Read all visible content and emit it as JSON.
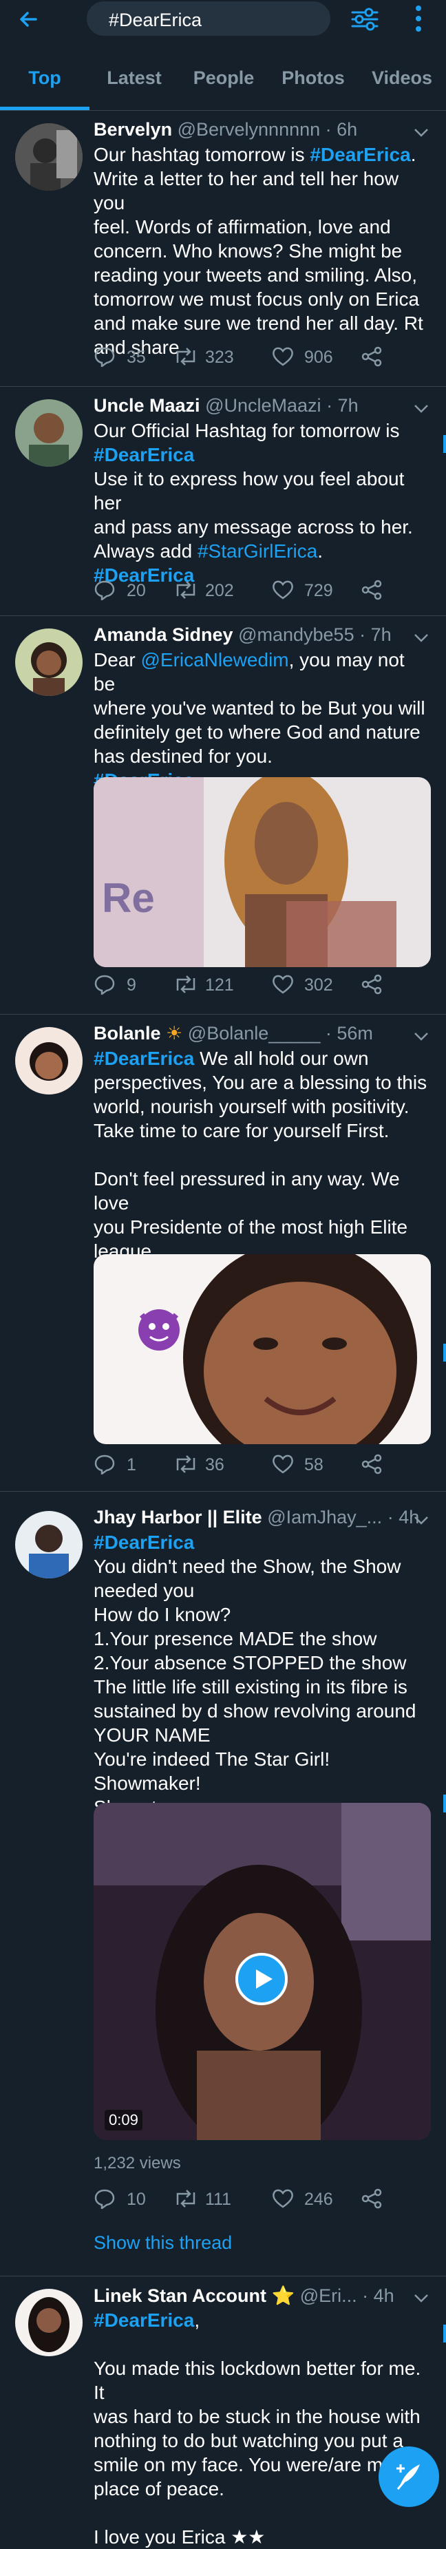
{
  "search": {
    "query": "#DearErica"
  },
  "tabs": [
    "Top",
    "Latest",
    "People",
    "Photos",
    "Videos"
  ],
  "tweets": [
    {
      "name": "Bervelyn",
      "handle": "@Bervelynnnnnn",
      "time": "· 6h",
      "lines": [
        [
          {
            "t": "Our hashtag tomorrow is "
          },
          {
            "t": "#DearErica",
            "c": "hash"
          },
          {
            "t": "."
          }
        ],
        [
          {
            "t": "Write a letter to her and tell her how you"
          }
        ],
        [
          {
            "t": "feel. Words of affirmation, love and"
          }
        ],
        [
          {
            "t": "concern. Who knows? She might be"
          }
        ],
        [
          {
            "t": "reading your tweets and smiling. Also,"
          }
        ],
        [
          {
            "t": "tomorrow we must focus only on Erica"
          }
        ],
        [
          {
            "t": "and make sure we trend her all day. Rt"
          }
        ],
        [
          {
            "t": "and share"
          }
        ]
      ],
      "replies": "35",
      "retweets": "323",
      "likes": "906"
    },
    {
      "name": "Uncle Maazi",
      "handle": "@UncleMaazi",
      "time": "· 7h",
      "lines": [
        [
          {
            "t": "Our Official Hashtag for tomorrow is"
          }
        ],
        [
          {
            "t": "#DearErica",
            "c": "hash"
          }
        ],
        [
          {
            "t": "Use it to express how you feel about her"
          }
        ],
        [
          {
            "t": "and pass any message across to her."
          }
        ],
        [
          {
            "t": "Always add "
          },
          {
            "t": "#StarGirlErica",
            "c": "mention"
          },
          {
            "t": "."
          }
        ],
        [
          {
            "t": "#DearErica",
            "c": "hash"
          }
        ]
      ],
      "replies": "20",
      "retweets": "202",
      "likes": "729"
    },
    {
      "name": "Amanda Sidney",
      "handle": "@mandybe55",
      "time": "· 7h",
      "lines": [
        [
          {
            "t": "Dear "
          },
          {
            "t": "@EricaNlewedim",
            "c": "mention"
          },
          {
            "t": ",  you may not be"
          }
        ],
        [
          {
            "t": "where you've wanted to be But you will"
          }
        ],
        [
          {
            "t": "definitely get to where God and nature"
          }
        ],
        [
          {
            "t": "has destined for you."
          }
        ],
        [
          {
            "t": "#DearErica",
            "c": "hash"
          }
        ]
      ],
      "replies": "9",
      "retweets": "121",
      "likes": "302"
    },
    {
      "name": "Bolanle",
      "emoji": "☀",
      "handle": "@Bolanle_____",
      "time": "· 56m",
      "lines": [
        [
          {
            "t": "#DearErica",
            "c": "hash"
          },
          {
            "t": " We all hold our own"
          }
        ],
        [
          {
            "t": "perspectives, You are a blessing to this"
          }
        ],
        [
          {
            "t": "world, nourish yourself with positivity."
          }
        ],
        [
          {
            "t": "Take time to care for yourself First."
          }
        ],
        [
          {
            "t": ""
          }
        ],
        [
          {
            "t": "Don't feel pressured in any way. We love"
          }
        ],
        [
          {
            "t": "you Presidente of the most high Elite"
          }
        ],
        [
          {
            "t": "league"
          }
        ]
      ],
      "replies": "1",
      "retweets": "36",
      "likes": "58"
    },
    {
      "name": "Jhay Harbor || Elite",
      "handle": "@IamJhay_...",
      "time": "· 4h",
      "lines": [
        [
          {
            "t": "#DearErica",
            "c": "hash"
          }
        ],
        [
          {
            "t": "You didn't need the Show, the Show"
          }
        ],
        [
          {
            "t": "needed you"
          }
        ],
        [
          {
            "t": "How do I know?"
          }
        ],
        [
          {
            "t": "1.Your presence MADE the show"
          }
        ],
        [
          {
            "t": "2.Your absence STOPPED the show"
          }
        ],
        [
          {
            "t": "The little life still existing in its fibre is"
          }
        ],
        [
          {
            "t": "sustained by d show revolving around"
          }
        ],
        [
          {
            "t": "YOUR NAME"
          }
        ],
        [
          {
            "t": "You're indeed The Star Girl! Showmaker!"
          }
        ],
        [
          {
            "t": "Showstopper"
          }
        ]
      ],
      "video_time": "0:09",
      "views": "1,232 views",
      "replies": "10",
      "retweets": "111",
      "likes": "246",
      "show_thread": "Show this thread"
    },
    {
      "name": "Linek Stan Account",
      "emoji": "⭐",
      "handle": "@Eri...",
      "time": "· 4h",
      "lines": [
        [
          {
            "t": "#DearErica",
            "c": "hash"
          },
          {
            "t": ","
          }
        ],
        [
          {
            "t": ""
          }
        ],
        [
          {
            "t": "You made this lockdown better for me. It"
          }
        ],
        [
          {
            "t": "was hard to be stuck in the house with"
          }
        ],
        [
          {
            "t": "nothing to do but watching you put a"
          }
        ],
        [
          {
            "t": "smile on my face.  You were/are my"
          }
        ],
        [
          {
            "t": "place of peace."
          }
        ],
        [
          {
            "t": ""
          }
        ],
        [
          {
            "t": "I love you Erica ★★"
          }
        ]
      ]
    }
  ],
  "colors": {
    "background": "#15202b",
    "accent": "#1da1f2",
    "muted": "#8899a6",
    "divider": "#38444d"
  }
}
